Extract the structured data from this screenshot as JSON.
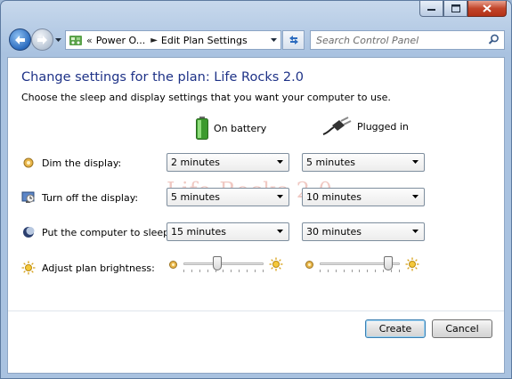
{
  "nav": {
    "breadcrumb_root": "Power O...",
    "breadcrumb_current": "Edit Plan Settings",
    "overflow_chevron": "«",
    "separator": "►",
    "search_placeholder": "Search Control Panel"
  },
  "main": {
    "title": "Change settings for the plan: Life Rocks 2.0",
    "subtitle": "Choose the sleep and display settings that you want your computer to use.",
    "columns": {
      "battery": "On battery",
      "plugged": "Plugged in"
    },
    "rows": [
      {
        "label": "Dim the display:",
        "battery": "2 minutes",
        "plugged": "5 minutes"
      },
      {
        "label": "Turn off the display:",
        "battery": "5 minutes",
        "plugged": "10 minutes"
      },
      {
        "label": "Put the computer to sleep:",
        "battery": "15 minutes",
        "plugged": "30 minutes"
      }
    ],
    "brightness": {
      "label": "Adjust plan brightness:",
      "battery_level": 0.42,
      "plugged_level": 0.86
    },
    "watermark": "Life Rocks 2.0"
  },
  "buttons": {
    "create": "Create",
    "cancel": "Cancel"
  },
  "colors": {
    "title": "#1e3287",
    "accent": "#2c6cbf",
    "close": "#c2452a"
  }
}
